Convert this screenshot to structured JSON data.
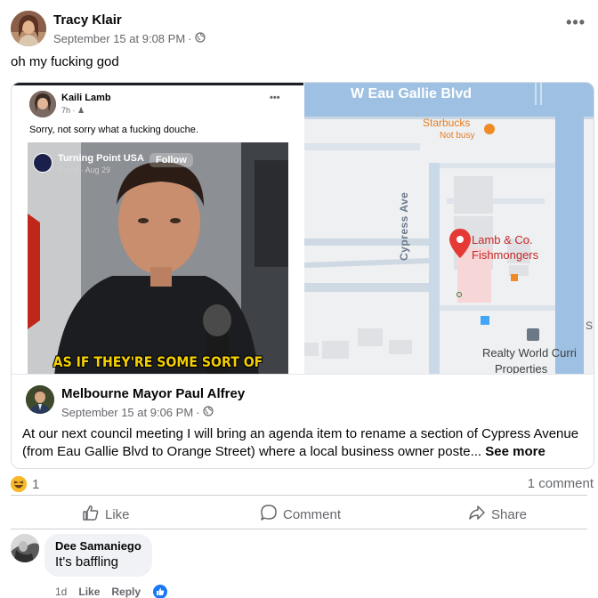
{
  "post": {
    "author": "Tracy Klair",
    "timestamp": "September 15 at 9:08 PM",
    "separator": "·",
    "privacy_icon": "globe-icon",
    "more_icon": "more-dots-icon",
    "text": "oh my fucking god"
  },
  "shared_image": {
    "inner_post": {
      "author": "Kaili Lamb",
      "meta": "7h ·",
      "text": "Sorry, not sorry what a fucking douche.",
      "reel": {
        "page_name": "Turning Point USA",
        "sub": "Reels · Aug 29",
        "follow_label": "Follow",
        "caption": "AS IF THEY'RE SOME SORT OF"
      }
    },
    "map": {
      "road_main": "W Eau Gallie Blvd",
      "road_side": "Cypress Ave",
      "poi_starbucks": "Starbucks",
      "poi_starbucks_status": "Not busy",
      "poi_pin_line1": "Lamb & Co.",
      "poi_pin_line2": "Fishmongers",
      "poi_realty_line1": "Realty World Curri",
      "poi_realty_line2": "Properties",
      "edge_letter": "S"
    }
  },
  "link_preview": {
    "author": "Melbourne Mayor Paul Alfrey",
    "timestamp": "September 15 at 9:06 PM",
    "separator": "·",
    "text": "At our next council meeting I will bring an agenda item to rename a section of Cypress Avenue (from Eau Gallie Blvd to Orange Street) where a local business owner poste...",
    "see_more": "See more"
  },
  "reactions": {
    "icon": "haha-reaction-icon",
    "count": "1",
    "comments": "1 comment"
  },
  "actions": {
    "like": "Like",
    "comment": "Comment",
    "share": "Share"
  },
  "comment": {
    "author": "Dee Samaniego",
    "text": "It's baffling",
    "time": "1d",
    "like": "Like",
    "reply": "Reply"
  },
  "colors": {
    "accent": "#1877f2",
    "secondary_text": "#65676b",
    "map_road": "#aac6e0",
    "map_pin": "#e53935"
  }
}
